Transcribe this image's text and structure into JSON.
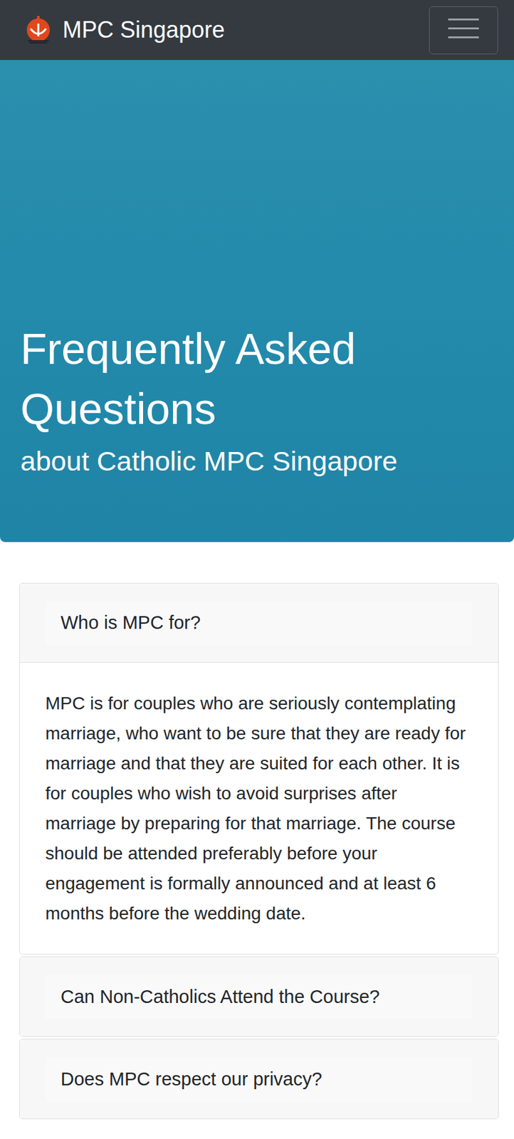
{
  "navbar": {
    "title": "MPC Singapore"
  },
  "hero": {
    "title": "Frequently Asked Questions",
    "subtitle": "about Catholic MPC Singapore"
  },
  "faq": [
    {
      "question": "Who is MPC for?",
      "expanded": true,
      "answer": "MPC is for couples who are seriously contemplating marriage, who want to be sure that they are ready for marriage and that they are suited for each other. It is for couples who wish to avoid surprises after marriage by preparing for that marriage. The course should be attended preferably before your engagement is formally announced and at least 6 months before the wedding date."
    },
    {
      "question": "Can Non-Catholics Attend the Course?",
      "expanded": false
    },
    {
      "question": "Does MPC respect our privacy?",
      "expanded": false
    }
  ]
}
